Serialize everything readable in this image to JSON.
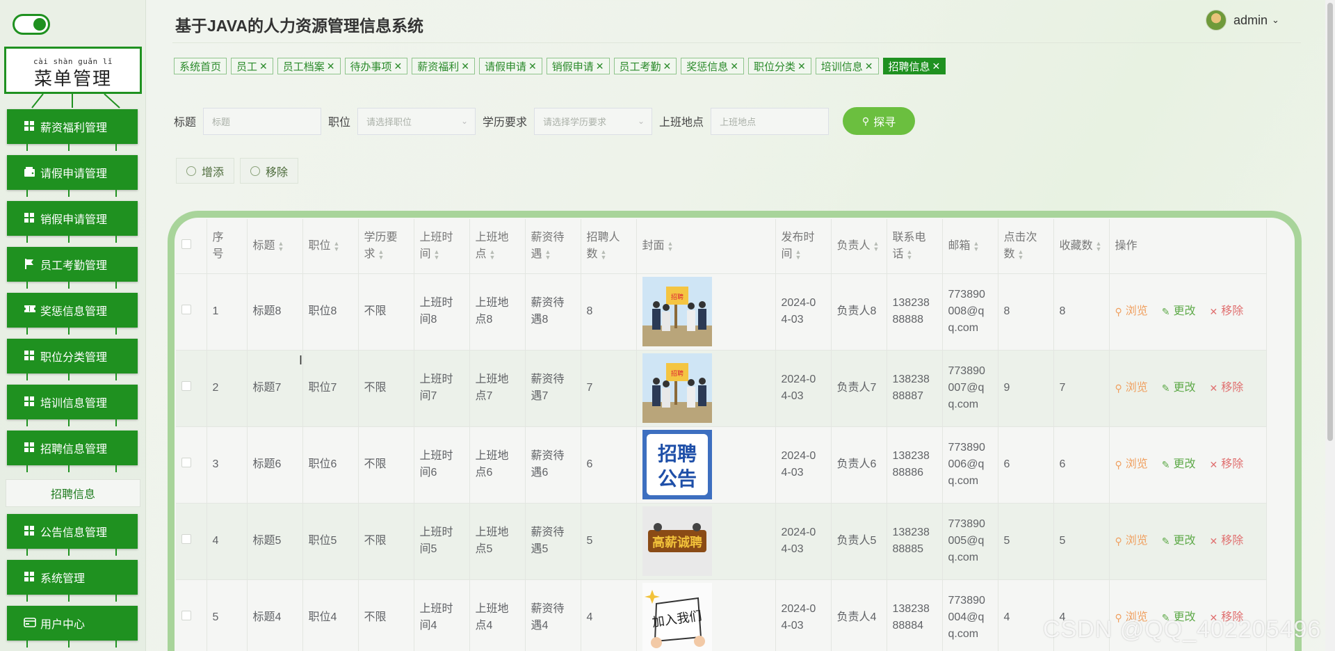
{
  "app": {
    "title": "基于JAVA的人力资源管理信息系统"
  },
  "user": {
    "name": "admin"
  },
  "sidebar": {
    "menu_pinyin": "cài shàn guǎn lǐ",
    "menu_title": "菜单管理",
    "items": [
      {
        "label": "薪资福利管理",
        "icon": "grid-icon"
      },
      {
        "label": "请假申请管理",
        "icon": "wallet-icon"
      },
      {
        "label": "销假申请管理",
        "icon": "grid-icon"
      },
      {
        "label": "员工考勤管理",
        "icon": "flag-icon"
      },
      {
        "label": "奖惩信息管理",
        "icon": "ticket-icon"
      },
      {
        "label": "职位分类管理",
        "icon": "grid-icon"
      },
      {
        "label": "培训信息管理",
        "icon": "grid-icon"
      },
      {
        "label": "招聘信息管理",
        "icon": "grid-icon"
      },
      {
        "label": "公告信息管理",
        "icon": "grid-icon"
      },
      {
        "label": "系统管理",
        "icon": "grid-icon"
      },
      {
        "label": "用户中心",
        "icon": "card-icon"
      }
    ],
    "active_sub": "招聘信息"
  },
  "tabs": [
    {
      "label": "系统首页",
      "closable": false
    },
    {
      "label": "员工",
      "closable": true
    },
    {
      "label": "员工档案",
      "closable": true
    },
    {
      "label": "待办事项",
      "closable": true
    },
    {
      "label": "薪资福利",
      "closable": true
    },
    {
      "label": "请假申请",
      "closable": true
    },
    {
      "label": "销假申请",
      "closable": true
    },
    {
      "label": "员工考勤",
      "closable": true
    },
    {
      "label": "奖惩信息",
      "closable": true
    },
    {
      "label": "职位分类",
      "closable": true
    },
    {
      "label": "培训信息",
      "closable": true
    },
    {
      "label": "招聘信息",
      "closable": true,
      "active": true
    }
  ],
  "search": {
    "title_label": "标题",
    "title_placeholder": "标题",
    "position_label": "职位",
    "position_placeholder": "请选择职位",
    "education_label": "学历要求",
    "education_placeholder": "请选择学历要求",
    "location_label": "上班地点",
    "location_placeholder": "上班地点",
    "button": "探寻"
  },
  "actions": {
    "add": "增添",
    "remove": "移除"
  },
  "table": {
    "headers": [
      "序号",
      "标题",
      "职位",
      "学历要求",
      "上班时间",
      "上班地点",
      "薪资待遇",
      "招聘人数",
      "封面",
      "发布时间",
      "负责人",
      "联系电话",
      "邮箱",
      "点击次数",
      "收藏数",
      "操作"
    ],
    "header_lines": [
      [
        "序",
        "号"
      ],
      [
        "标题"
      ],
      [
        "职位"
      ],
      [
        "学历要",
        "求"
      ],
      [
        "上班时",
        "间"
      ],
      [
        "上班地",
        "点"
      ],
      [
        "薪资待",
        "遇"
      ],
      [
        "招聘人",
        "数"
      ],
      [
        "封面"
      ],
      [
        "发布时",
        "间"
      ],
      [
        "负责人"
      ],
      [
        "联系电",
        "话"
      ],
      [
        "邮箱"
      ],
      [
        "点击次",
        "数"
      ],
      [
        "收藏数"
      ],
      [
        "操作"
      ]
    ],
    "ops": {
      "view": "浏览",
      "edit": "更改",
      "delete": "移除"
    },
    "rows": [
      {
        "no": "1",
        "title": "标题8",
        "position": "职位8",
        "education": "不限",
        "time": [
          "上班时",
          "间8"
        ],
        "place": [
          "上班地",
          "点8"
        ],
        "salary": [
          "薪资待",
          "遇8"
        ],
        "count": "8",
        "cover": "recruit-stage",
        "date": [
          "2024-0",
          "4-03"
        ],
        "owner": "负责人8",
        "phone": [
          "138238",
          "88888"
        ],
        "email": [
          "773890",
          "008@q",
          "q.com"
        ],
        "clicks": "8",
        "favs": "8"
      },
      {
        "no": "2",
        "title": "标题7",
        "position": "职位7",
        "education": "不限",
        "time": [
          "上班时",
          "间7"
        ],
        "place": [
          "上班地",
          "点7"
        ],
        "salary": [
          "薪资待",
          "遇7"
        ],
        "count": "7",
        "cover": "recruit-stage",
        "date": [
          "2024-0",
          "4-03"
        ],
        "owner": "负责人7",
        "phone": [
          "138238",
          "88887"
        ],
        "email": [
          "773890",
          "007@q",
          "q.com"
        ],
        "clicks": "9",
        "favs": "7"
      },
      {
        "no": "3",
        "title": "标题6",
        "position": "职位6",
        "education": "不限",
        "time": [
          "上班时",
          "间6"
        ],
        "place": [
          "上班地",
          "点6"
        ],
        "salary": [
          "薪资待",
          "遇6"
        ],
        "count": "6",
        "cover": "recruit-notice",
        "date": [
          "2024-0",
          "4-03"
        ],
        "owner": "负责人6",
        "phone": [
          "138238",
          "88886"
        ],
        "email": [
          "773890",
          "006@q",
          "q.com"
        ],
        "clicks": "6",
        "favs": "6"
      },
      {
        "no": "4",
        "title": "标题5",
        "position": "职位5",
        "education": "不限",
        "time": [
          "上班时",
          "间5"
        ],
        "place": [
          "上班地",
          "点5"
        ],
        "salary": [
          "薪资待",
          "遇5"
        ],
        "count": "5",
        "cover": "recruit-gold",
        "date": [
          "2024-0",
          "4-03"
        ],
        "owner": "负责人5",
        "phone": [
          "138238",
          "88885"
        ],
        "email": [
          "773890",
          "005@q",
          "q.com"
        ],
        "clicks": "5",
        "favs": "5"
      },
      {
        "no": "5",
        "title": "标题4",
        "position": "职位4",
        "education": "不限",
        "time": [
          "上班时",
          "间4"
        ],
        "place": [
          "上班地",
          "点4"
        ],
        "salary": [
          "薪资待",
          "遇4"
        ],
        "count": "4",
        "cover": "join-us",
        "date": [
          "2024-0",
          "4-03"
        ],
        "owner": "负责人4",
        "phone": [
          "138238",
          "88884"
        ],
        "email": [
          "773890",
          "004@q",
          "q.com"
        ],
        "clicks": "4",
        "favs": "4"
      }
    ]
  },
  "watermark": "CSDN @QQ_402205496",
  "colors": {
    "primary": "#1f9120",
    "accent": "#6bbf3f",
    "frame": "#a8d49a"
  }
}
